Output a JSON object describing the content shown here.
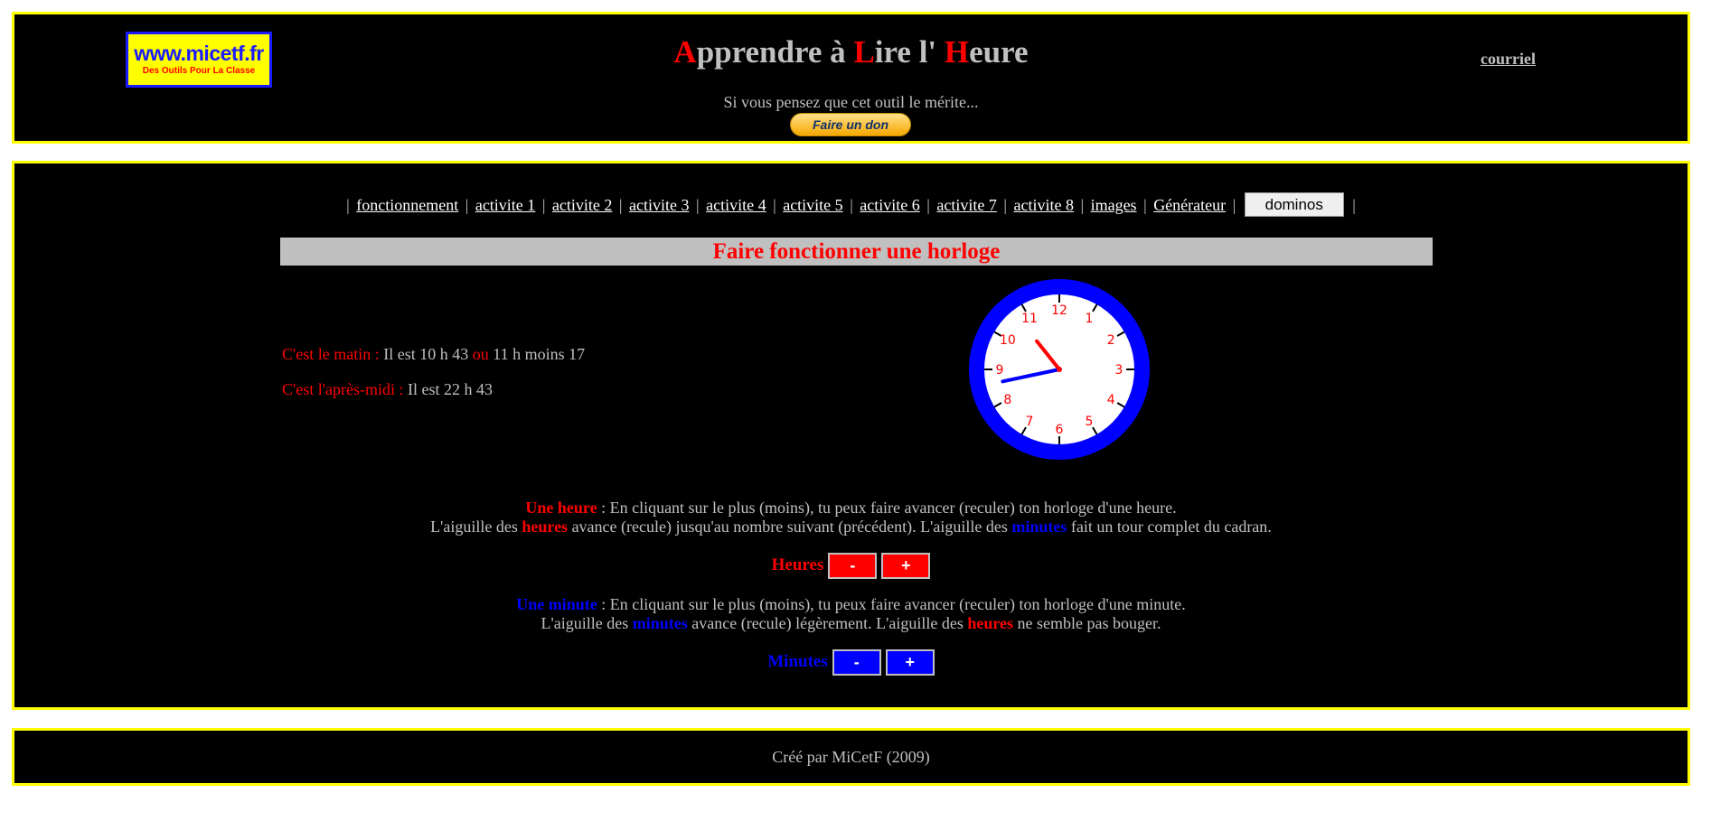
{
  "header": {
    "logo_main": "www.micetf.fr",
    "logo_sub": "Des Outils Pour La Classe",
    "title_letters": [
      {
        "text": "A",
        "red": true
      },
      {
        "text": "pprendre à ",
        "red": false
      },
      {
        "text": "L",
        "red": true
      },
      {
        "text": "ire l' ",
        "red": false
      },
      {
        "text": "H",
        "red": true
      },
      {
        "text": "eure",
        "red": false
      }
    ],
    "mail_link": "courriel",
    "merit_text": "Si vous pensez que cet outil le mérite...",
    "donate_label": "Faire un don"
  },
  "nav": {
    "links": [
      "fonctionnement",
      "activite 1",
      "activite 2",
      "activite 3",
      "activite 4",
      "activite 5",
      "activite 6",
      "activite 7",
      "activite 8",
      "images",
      "Générateur"
    ],
    "button": "dominos",
    "separator": "|"
  },
  "section": {
    "title": "Faire fonctionner une horloge"
  },
  "time": {
    "morning_label": "C'est le matin :",
    "morning_value": "Il est 10 h 43",
    "or_label": "ou",
    "morning_alt": "11 h moins 17",
    "afternoon_label": "C'est l'après-midi :",
    "afternoon_value": "Il est 22 h 43"
  },
  "clock": {
    "hours": 10,
    "minutes": 43,
    "numbers": [
      "12",
      "1",
      "2",
      "3",
      "4",
      "5",
      "6",
      "7",
      "8",
      "9",
      "10",
      "11"
    ],
    "ring_color": "#0000ff",
    "face_color": "#ffffff",
    "number_color": "#ff0000",
    "hour_hand_color": "#ff0000",
    "minute_hand_color": "#0000ff"
  },
  "hours_help": {
    "keyword": "Une heure",
    "line1_rest": " : En cliquant sur le plus (moins), tu peux faire avancer (reculer) ton horloge d'une heure.",
    "line2_a": "L'aiguille des ",
    "line2_hours": "heures",
    "line2_b": " avance (recule) jusqu'au nombre suivant (précédent). L'aiguille des ",
    "line2_minutes": "minutes",
    "line2_c": " fait un tour complet du cadran."
  },
  "hours_control": {
    "label": "Heures",
    "minus": "-",
    "plus": "+"
  },
  "minutes_help": {
    "keyword": "Une minute",
    "line1_rest": " : En cliquant sur le plus (moins), tu peux faire avancer (reculer) ton horloge d'une minute.",
    "line2_a": "L'aiguille des ",
    "line2_minutes": "minutes",
    "line2_b": " avance (recule) légèrement. L'aiguille des ",
    "line2_hours": "heures",
    "line2_c": " ne semble pas bouger."
  },
  "minutes_control": {
    "label": "Minutes",
    "minus": "-",
    "plus": "+"
  },
  "footer": {
    "text": "Créé par MiCetF (2009)"
  }
}
